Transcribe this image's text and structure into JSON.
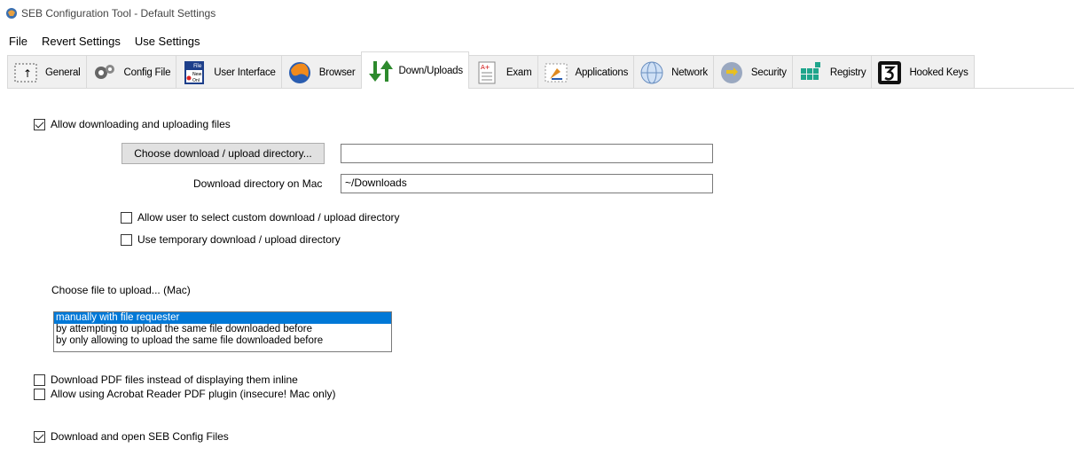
{
  "window": {
    "title": "SEB Configuration Tool - Default Settings"
  },
  "menu": {
    "file": "File",
    "revert": "Revert Settings",
    "use": "Use Settings"
  },
  "tabs": [
    {
      "label": "General",
      "icon": "general-icon"
    },
    {
      "label": "Config File",
      "icon": "config-file-icon"
    },
    {
      "label": "User Interface",
      "icon": "user-interface-icon"
    },
    {
      "label": "Browser",
      "icon": "browser-icon"
    },
    {
      "label": "Down/Uploads",
      "icon": "down-uploads-icon",
      "active": true
    },
    {
      "label": "Exam",
      "icon": "exam-icon"
    },
    {
      "label": "Applications",
      "icon": "applications-icon"
    },
    {
      "label": "Network",
      "icon": "network-icon"
    },
    {
      "label": "Security",
      "icon": "security-icon"
    },
    {
      "label": "Registry",
      "icon": "registry-icon"
    },
    {
      "label": "Hooked Keys",
      "icon": "hooked-keys-icon"
    }
  ],
  "icon_text": {
    "file_badge": "File",
    "new_badge": "New",
    "onl_badge": "Onl",
    "a_plus": "A+"
  },
  "page": {
    "allow_downloading": {
      "label": "Allow downloading and uploading files",
      "checked": true
    },
    "choose_dir_button": "Choose download / upload directory...",
    "download_dir_value": "",
    "mac_dir_label": "Download directory on Mac",
    "mac_dir_value": "~/Downloads",
    "allow_custom_dir": {
      "label": "Allow user to select custom download / upload directory",
      "checked": false
    },
    "use_temp_dir": {
      "label": "Use temporary download / upload directory",
      "checked": false
    },
    "choose_upload_label": "Choose file to upload... (Mac)",
    "upload_options": [
      "manually with file requester",
      "by attempting to upload the same file downloaded before",
      "by only allowing to upload the same file downloaded before"
    ],
    "upload_selected_index": 0,
    "download_pdf": {
      "label": "Download PDF files instead of displaying them inline",
      "checked": false
    },
    "acrobat_plugin": {
      "label": "Allow using Acrobat Reader PDF plugin (insecure! Mac only)",
      "checked": false
    },
    "open_seb_config": {
      "label": "Download and open SEB Config Files",
      "checked": true
    }
  },
  "colors": {
    "selection": "#0078d7",
    "tab_bg": "#f0f0f0",
    "button_bg": "#e1e1e1"
  }
}
